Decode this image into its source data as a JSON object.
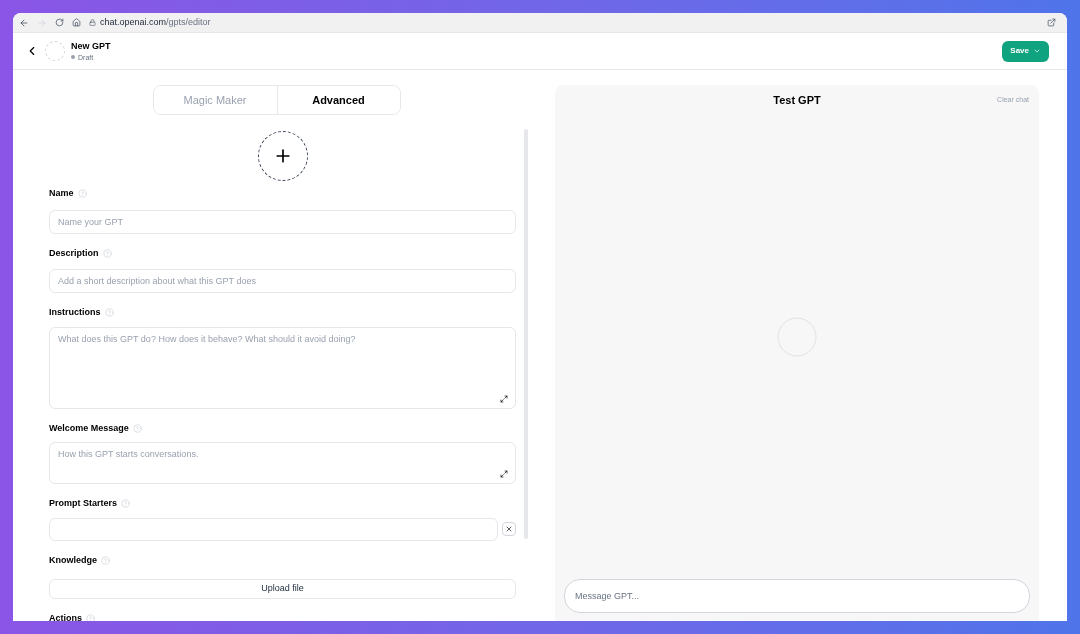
{
  "browser": {
    "url_host": "chat.openai.com",
    "url_path": "/gpts/editor"
  },
  "header": {
    "title": "New GPT",
    "status": "Draft",
    "save_label": "Save"
  },
  "tabs": [
    {
      "label": "Magic Maker",
      "selected": false
    },
    {
      "label": "Advanced",
      "selected": true
    }
  ],
  "fields": [
    {
      "kind": "input",
      "label": "Name",
      "placeholder": "Name your GPT"
    },
    {
      "kind": "input",
      "label": "Description",
      "placeholder": "Add a short description about what this GPT does"
    },
    {
      "kind": "textarea",
      "label": "Instructions",
      "placeholder": "What does this GPT do? How does it behave? What should it avoid doing?"
    },
    {
      "kind": "textarea-small",
      "label": "Welcome Message",
      "placeholder": "How this GPT starts conversations."
    },
    {
      "kind": "starter",
      "label": "Prompt Starters"
    },
    {
      "kind": "upload",
      "label": "Knowledge",
      "button": "Upload file"
    },
    {
      "kind": "heading",
      "label": "Actions"
    }
  ],
  "preview": {
    "title": "Test GPT",
    "clear_label": "Clear chat",
    "message_placeholder": "Message GPT..."
  }
}
